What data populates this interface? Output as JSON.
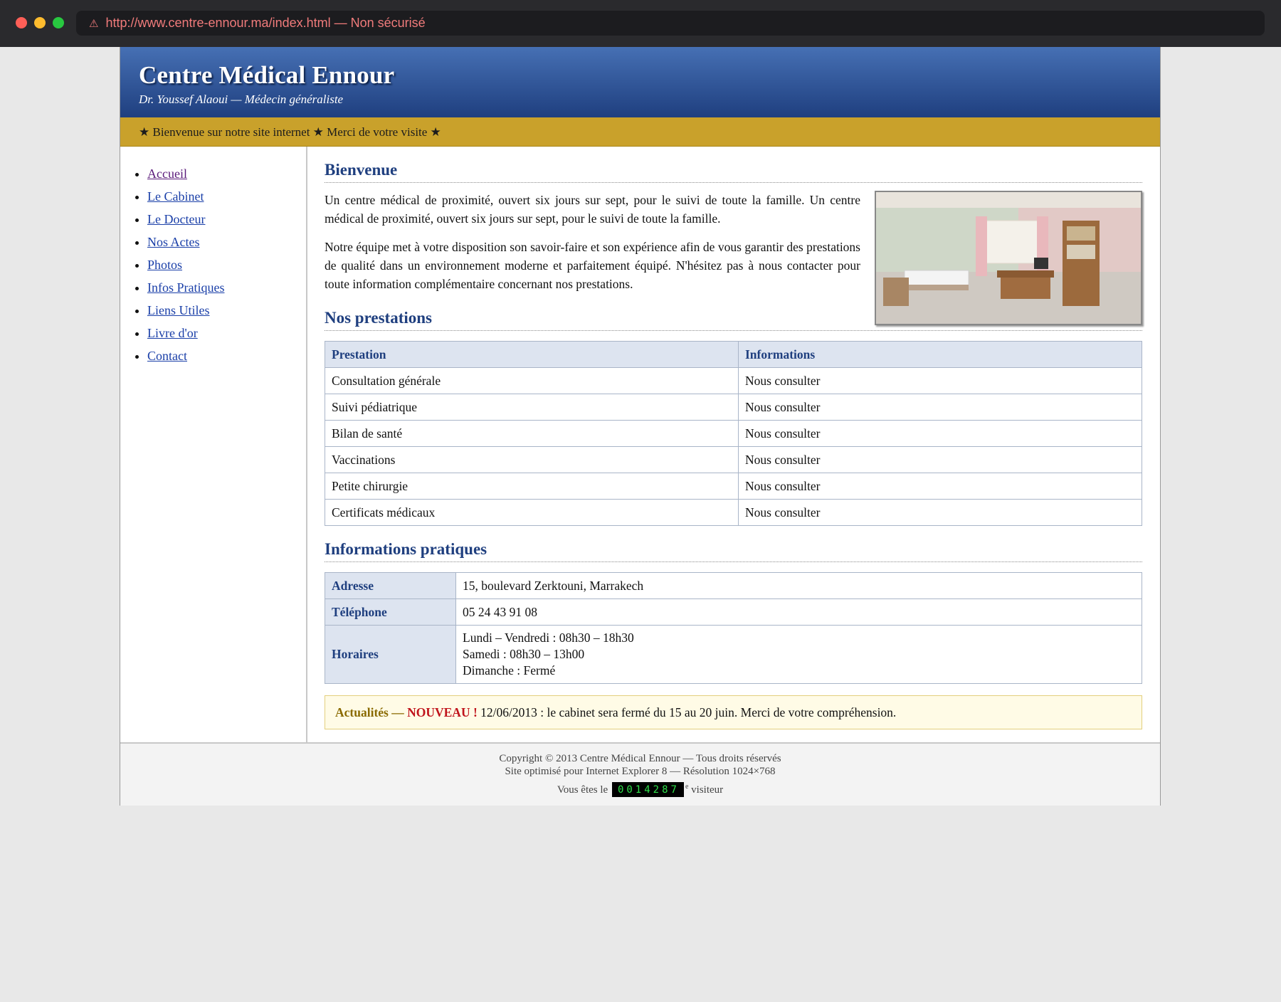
{
  "browser": {
    "url": "http://www.centre-ennour.ma/index.html — Non sécurisé"
  },
  "header": {
    "title": "Centre Médical Ennour",
    "subtitle": "Dr. Youssef Alaoui — Médecin généraliste"
  },
  "marquee": "★ Bienvenue sur notre site internet ★ Merci de votre visite ★",
  "nav": [
    {
      "label": "Accueil"
    },
    {
      "label": "Le Cabinet"
    },
    {
      "label": "Le Docteur"
    },
    {
      "label": "Nos Actes"
    },
    {
      "label": "Photos"
    },
    {
      "label": "Infos Pratiques"
    },
    {
      "label": "Liens Utiles"
    },
    {
      "label": "Livre d'or"
    },
    {
      "label": "Contact"
    }
  ],
  "welcome": {
    "heading": "Bienvenue",
    "para1": "Un centre médical de proximité, ouvert six jours sur sept, pour le suivi de toute la famille. Un centre médical de proximité, ouvert six jours sur sept, pour le suivi de toute la famille.",
    "para2": "Notre équipe met à votre disposition son savoir-faire et son expérience afin de vous garantir des prestations de qualité dans un environnement moderne et parfaitement équipé. N'hésitez pas à nous contacter pour toute information complémentaire concernant nos prestations."
  },
  "prestations": {
    "heading": "Nos prestations",
    "col1": "Prestation",
    "col2": "Informations",
    "rows": [
      {
        "name": "Consultation générale",
        "info": "Nous consulter"
      },
      {
        "name": "Suivi pédiatrique",
        "info": "Nous consulter"
      },
      {
        "name": "Bilan de santé",
        "info": "Nous consulter"
      },
      {
        "name": "Vaccinations",
        "info": "Nous consulter"
      },
      {
        "name": "Petite chirurgie",
        "info": "Nous consulter"
      },
      {
        "name": "Certificats médicaux",
        "info": "Nous consulter"
      }
    ]
  },
  "infos": {
    "heading": "Informations pratiques",
    "adresse_label": "Adresse",
    "adresse": "15, boulevard Zerktouni, Marrakech",
    "telephone_label": "Téléphone",
    "telephone": "05 24 43 91 08",
    "horaires_label": "Horaires",
    "horaires": [
      "Lundi – Vendredi : 08h30 – 18h30",
      "Samedi : 08h30 – 13h00",
      "Dimanche : Fermé"
    ]
  },
  "news": {
    "label": "Actualités —",
    "new": "NOUVEAU !",
    "text": "12/06/2013 : le cabinet sera fermé du 15 au 20 juin. Merci de votre compréhension."
  },
  "footer": {
    "copyright": "Copyright © 2013 Centre Médical Ennour — Tous droits réservés",
    "optimized": "Site optimisé pour Internet Explorer 8 — Résolution 1024×768",
    "visitor_prefix": "Vous êtes le",
    "counter": "0014287",
    "visitor_suffix": "visiteur"
  },
  "colors": {
    "header_top": "#4670b4",
    "header_bottom": "#1f3f7f",
    "marquee": "#c9a12b",
    "link": "#1a3fa8",
    "visited_link": "#5a1a7a",
    "news_new": "#c0141c",
    "counter_digits": "#2fe04a"
  }
}
